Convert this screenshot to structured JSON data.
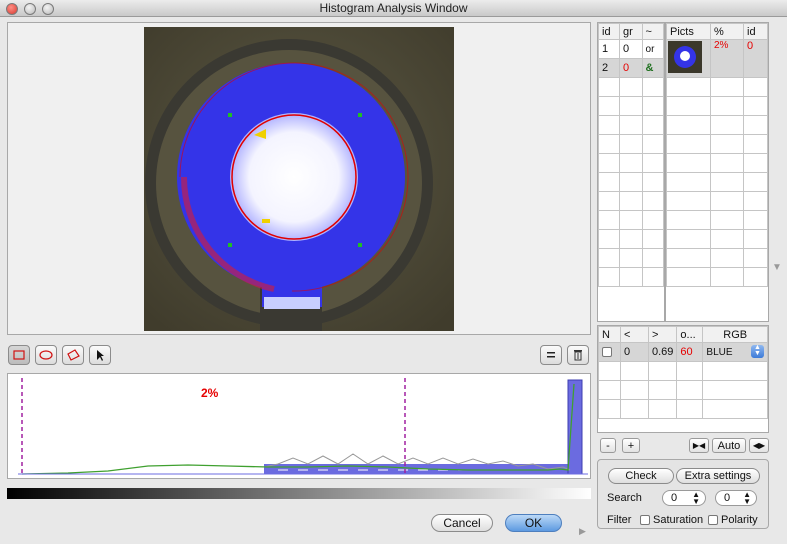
{
  "window": {
    "title": "Histogram Analysis Window"
  },
  "groups_table": {
    "headers": [
      "id",
      "gr",
      "~"
    ],
    "rows": [
      {
        "id": "1",
        "gr": "0",
        "sym": "or"
      },
      {
        "id": "2",
        "gr": "0",
        "sym": "&"
      }
    ]
  },
  "pict_table": {
    "headers": [
      "Picts",
      "%",
      "id"
    ],
    "rows": [
      {
        "percent": "2%",
        "id": "0"
      }
    ]
  },
  "range_table": {
    "headers": [
      "N",
      "<",
      ">",
      "o...",
      "RGB"
    ],
    "rows": [
      {
        "lt": "0",
        "gt": "0.69",
        "o": "60",
        "rgb": "BLUE"
      }
    ]
  },
  "range_controls": {
    "minus": "-",
    "plus": "+",
    "auto": "Auto"
  },
  "histogram": {
    "percent_label": "2%"
  },
  "settings": {
    "check": "Check",
    "extra": "Extra settings",
    "search_label": "Search",
    "search_a": "0",
    "search_b": "0",
    "filter_label": "Filter",
    "saturation": "Saturation",
    "polarity": "Polarity"
  },
  "dialog": {
    "cancel": "Cancel",
    "ok": "OK"
  },
  "colors": {
    "overlay": "#3d3df0",
    "marker": "#e00000",
    "threshold": "#a020a0",
    "curve": "#3fa02f"
  },
  "icons": [
    "rect-tool-icon",
    "ellipse-tool-icon",
    "polygon-tool-icon",
    "pointer-icon",
    "equals-icon",
    "trash-icon"
  ]
}
